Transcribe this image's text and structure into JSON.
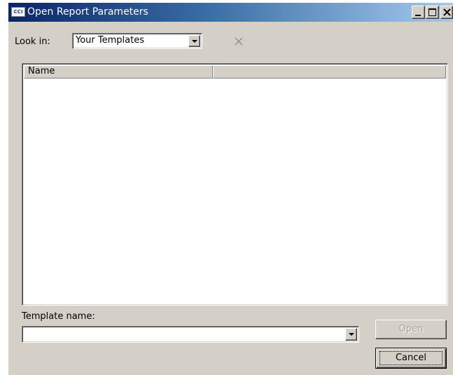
{
  "window": {
    "title": "Open Report Parameters",
    "icon_text": "CCI",
    "icon": "app-icon"
  },
  "controls": {
    "minimize_icon": "minimize-icon",
    "maximize_icon": "maximize-icon",
    "close_icon": "close-icon"
  },
  "look_in": {
    "label": "Look in:",
    "value": "Your Templates"
  },
  "toolbar": {
    "delete_icon": "delete-x-icon",
    "delete_icon_color": "#8c8c8c"
  },
  "list": {
    "columns": [
      "Name",
      ""
    ],
    "rows": []
  },
  "template_name": {
    "label": "Template name:",
    "value": ""
  },
  "buttons": {
    "open_label": "Open",
    "open_enabled": false,
    "cancel_label": "Cancel"
  },
  "colors": {
    "face": "#d4d0c8",
    "title_start": "#0a246a",
    "title_end": "#a6caf0"
  }
}
